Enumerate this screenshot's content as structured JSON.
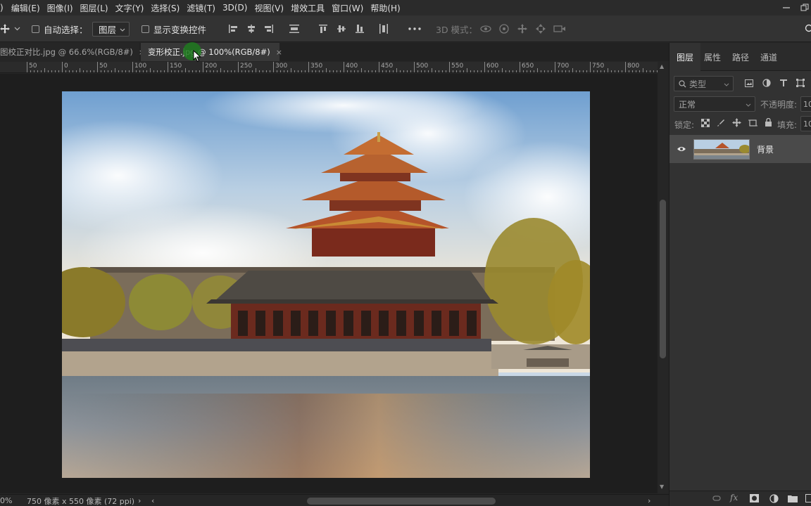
{
  "menu": [
    "编辑(E)",
    "图像(I)",
    "图层(L)",
    "文字(Y)",
    "选择(S)",
    "滤镜(T)",
    "3D(D)",
    "视图(V)",
    "增效工具",
    "窗口(W)",
    "帮助(H)"
  ],
  "menu_partial_left": ")",
  "options": {
    "auto_select_label": "自动选择：",
    "auto_select_value": "图层",
    "show_transform_label": "显示变换控件",
    "mode_3d_label": "3D 模式：",
    "more_icon": "more-icon"
  },
  "tabs": [
    {
      "label": "图校正对比.jpg @ 66.6%(RGB/8#)",
      "close": "×",
      "active": false
    },
    {
      "label": "变形校正.jpg @ 100%(RGB/8#)",
      "close": "×",
      "active": true
    }
  ],
  "ruler": [
    "50",
    "0",
    "50",
    "100",
    "150",
    "200",
    "250",
    "300",
    "350",
    "400",
    "450",
    "500",
    "550",
    "600",
    "650",
    "700",
    "750",
    "800"
  ],
  "status": {
    "zoom": "0%",
    "doc_info": "750 像素 x 550 像素 (72 ppi)",
    "arrow_right": "›",
    "arrow_left": "‹"
  },
  "panel": {
    "tabs": [
      "图层",
      "属性",
      "路径",
      "通道"
    ],
    "filter_placeholder": "类型",
    "blend_mode": "正常",
    "opacity_label": "不透明度:",
    "opacity_value": "10",
    "lock_label": "锁定:",
    "fill_label": "填充:",
    "fill_value": "10",
    "layer_name": "背景"
  },
  "colors": {
    "accent_cursor": "#1f7a1f",
    "panel_bg": "#323232",
    "canvas_bg": "#1e1e1e"
  }
}
